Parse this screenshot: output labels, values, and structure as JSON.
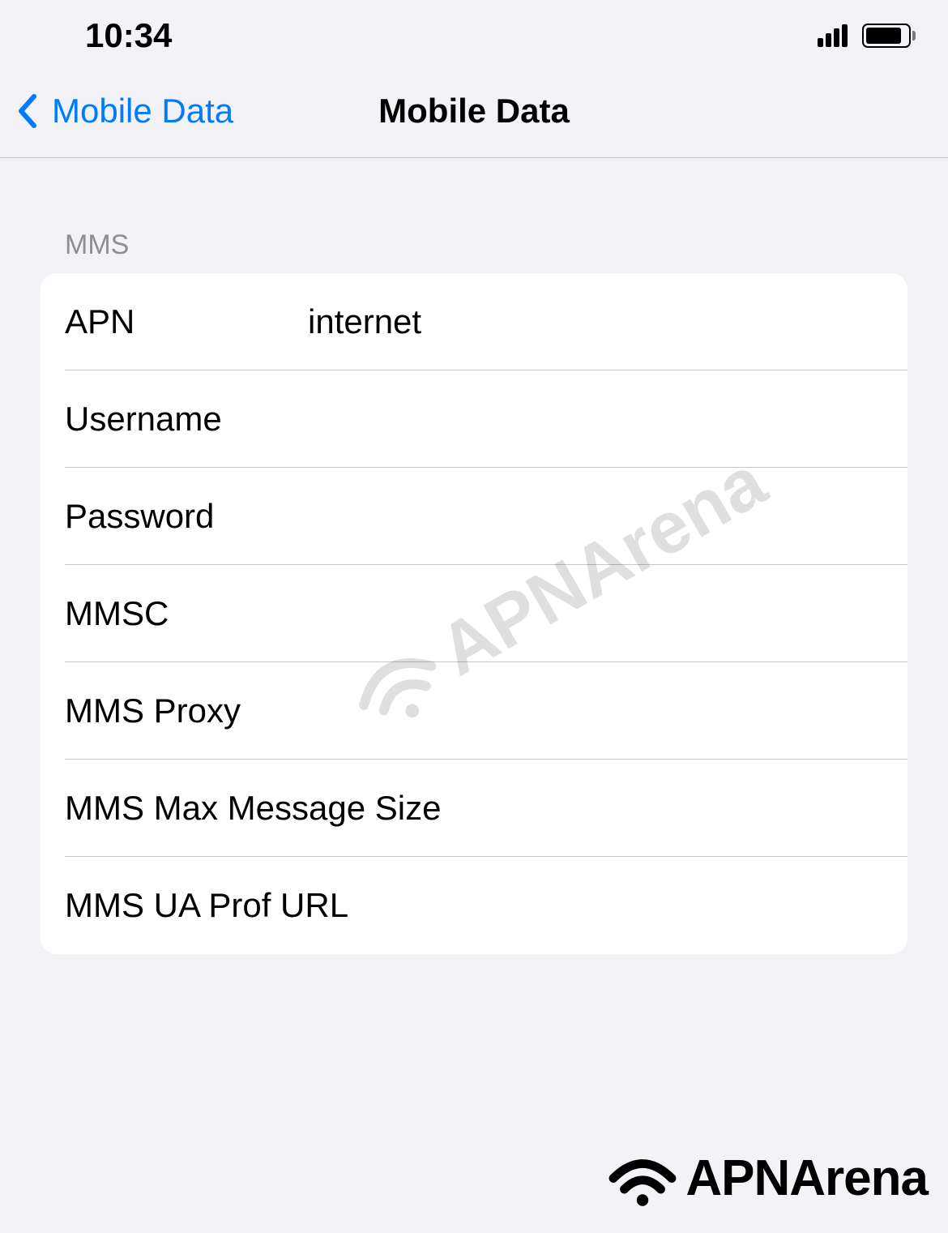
{
  "statusBar": {
    "time": "10:34"
  },
  "navBar": {
    "backLabel": "Mobile Data",
    "title": "Mobile Data"
  },
  "section": {
    "header": "MMS",
    "rows": [
      {
        "label": "APN",
        "value": "internet"
      },
      {
        "label": "Username",
        "value": ""
      },
      {
        "label": "Password",
        "value": ""
      },
      {
        "label": "MMSC",
        "value": ""
      },
      {
        "label": "MMS Proxy",
        "value": ""
      },
      {
        "label": "MMS Max Message Size",
        "value": ""
      },
      {
        "label": "MMS UA Prof URL",
        "value": ""
      }
    ]
  },
  "watermark": {
    "text": "APNArena"
  },
  "brand": {
    "text": "APNArena"
  }
}
